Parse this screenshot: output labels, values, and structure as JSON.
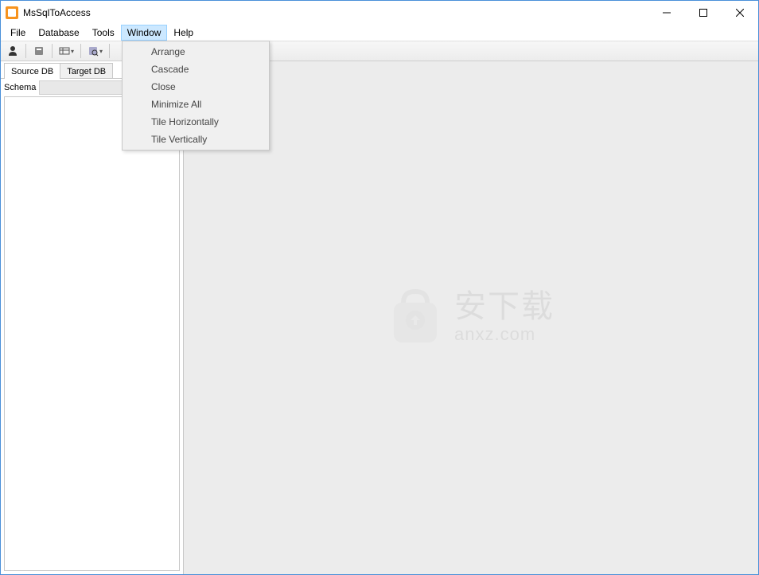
{
  "title": "MsSqlToAccess",
  "menubar": {
    "items": [
      "File",
      "Database",
      "Tools",
      "Window",
      "Help"
    ],
    "activeIndex": 3
  },
  "toolbar": {
    "icons": [
      "user-icon",
      "wizard-icon",
      "table-icon",
      "query-icon"
    ]
  },
  "leftPanel": {
    "tabs": {
      "source": "Source DB",
      "target": "Target DB",
      "activeIndex": 0
    },
    "schemaLabel": "Schema",
    "schemaValue": ""
  },
  "windowMenu": {
    "items": [
      "Arrange",
      "Cascade",
      "Close",
      "Minimize All",
      "Tile Horizontally",
      "Tile Vertically"
    ]
  },
  "watermark": {
    "cn": "安下载",
    "en": "anxz.com"
  }
}
